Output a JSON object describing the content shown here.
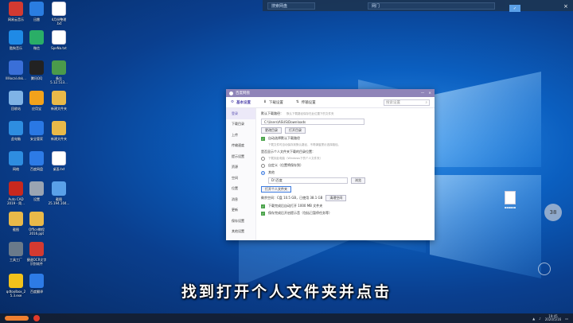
{
  "top_strip": {
    "left_box": "搜索网盘",
    "middle_box": "网门",
    "check_label": "✓",
    "close_label": "×"
  },
  "desktop_icons": [
    {
      "label": "网易云音乐",
      "icon": "music-icon",
      "color": "#d33a31"
    },
    {
      "label": "迅雷",
      "icon": "thunder-icon",
      "color": "#2a7de1"
    },
    {
      "label": "4月份整理\n.txt",
      "icon": "text-file-icon",
      "color": "#ffffff"
    },
    {
      "label": "酷狗音乐",
      "icon": "music-icon",
      "color": "#1f8ae6"
    },
    {
      "label": "微信",
      "icon": "wechat-icon",
      "color": "#2aae67"
    },
    {
      "label": "SpeNa.txt",
      "icon": "text-file-icon",
      "color": "#ffffff"
    },
    {
      "label": "lllllocal.dsk...",
      "icon": "app-icon",
      "color": "#3a6fd8"
    },
    {
      "label": "腾讯QQ",
      "icon": "qq-icon",
      "color": "#222222"
    },
    {
      "label": "备忘\n5.12.513...",
      "icon": "doc-icon",
      "color": "#4b9a4b"
    },
    {
      "label": "回收站",
      "icon": "trash-icon",
      "color": "#7fb3e6"
    },
    {
      "label": "应用宝",
      "icon": "apps-icon",
      "color": "#f2a21b"
    },
    {
      "label": "新建文件夹",
      "icon": "folder-icon",
      "color": "#e9b949"
    },
    {
      "label": "此电脑",
      "icon": "computer-icon",
      "color": "#2e8de0"
    },
    {
      "label": "安全管家",
      "icon": "shield-icon",
      "color": "#2a78e4"
    },
    {
      "label": "新建文件夹",
      "icon": "folder-icon",
      "color": "#e9b949"
    },
    {
      "label": "网络",
      "icon": "network-icon",
      "color": "#2e8de0"
    },
    {
      "label": "百度网盘",
      "icon": "cloud-icon",
      "color": "#2d7be6"
    },
    {
      "label": "桌面.txt",
      "icon": "text-file-icon",
      "color": "#ffffff"
    },
    {
      "label": "Auto CAD\n2019 - 简...",
      "icon": "cad-icon",
      "color": "#c8281e"
    },
    {
      "label": "设置",
      "icon": "gear-icon",
      "color": "#9aa4b2"
    },
    {
      "label": "截图\n25.194.104...",
      "icon": "image-icon",
      "color": "#5aa0e8"
    },
    {
      "label": "截图",
      "icon": "folder-icon",
      "color": "#e9b949"
    },
    {
      "label": "Office教程\n2016.ppt",
      "icon": "folder-icon",
      "color": "#e9b949"
    },
    {
      "label": "",
      "icon": "empty-icon",
      "color": "transparent"
    },
    {
      "label": "工具工厂",
      "icon": "tools-icon",
      "color": "#6a7a8a"
    },
    {
      "label": "捷速OCR文字\n识别软件",
      "icon": "ocr-icon",
      "color": "#d33a31"
    },
    {
      "label": "",
      "icon": "empty-icon",
      "color": "transparent"
    },
    {
      "label": "qdtoolbox_2\n5.3.exe",
      "icon": "app-icon",
      "color": "#f2c21b"
    },
    {
      "label": "百度翻译",
      "icon": "translate-icon",
      "color": "#2d7be6"
    }
  ],
  "window": {
    "title": "百度网盘",
    "tabs": [
      "基本设置",
      "下载设置",
      "传输设置"
    ],
    "search_placeholder": "搜索设置",
    "sidebar": [
      "登录",
      "下载目录",
      "上传",
      "传输速度",
      "提示设置",
      "资源",
      "空间",
      "位置",
      "消息",
      "更新",
      "保存设置",
      "其他设置"
    ],
    "section_label": "默认下载路径：",
    "section_hint": "默认下载路径保存在此位置下的文件夹",
    "path_value": "C:\\Users\\ASUS\\Downloads",
    "btn_change": "更改目录",
    "btn_open": "打开目录",
    "check1": "自动选择默认下载路径",
    "check1_hint": "下载文件时自动保存到默认路径，不再弹窗提示选择路径。",
    "question": "是否显示个人文件夹下载的目录位置：",
    "radio1": "下载到此电脑（Windows下的个人文件夹）",
    "radio2": "自定义（位置将保存到）",
    "radio3": "其他",
    "folder_value": "D:\\百度",
    "btn_browse": "浏览",
    "btn_open_personal": "打开个人文件夹",
    "capacity_text": "剩余空间：C盘 10.5 GB，已使用 38.1 GB",
    "btn_clean": "清理空间",
    "check2": "下载完成后自动打开 1000 MB 文件夹",
    "check3": "保存完成后开启提示音（包括已暂停任务等）"
  },
  "subtitle": "找到打开个人文件夹并点击",
  "widget_value": "38",
  "taskbar": {
    "time": "19:45",
    "date": "2020/5/16"
  }
}
